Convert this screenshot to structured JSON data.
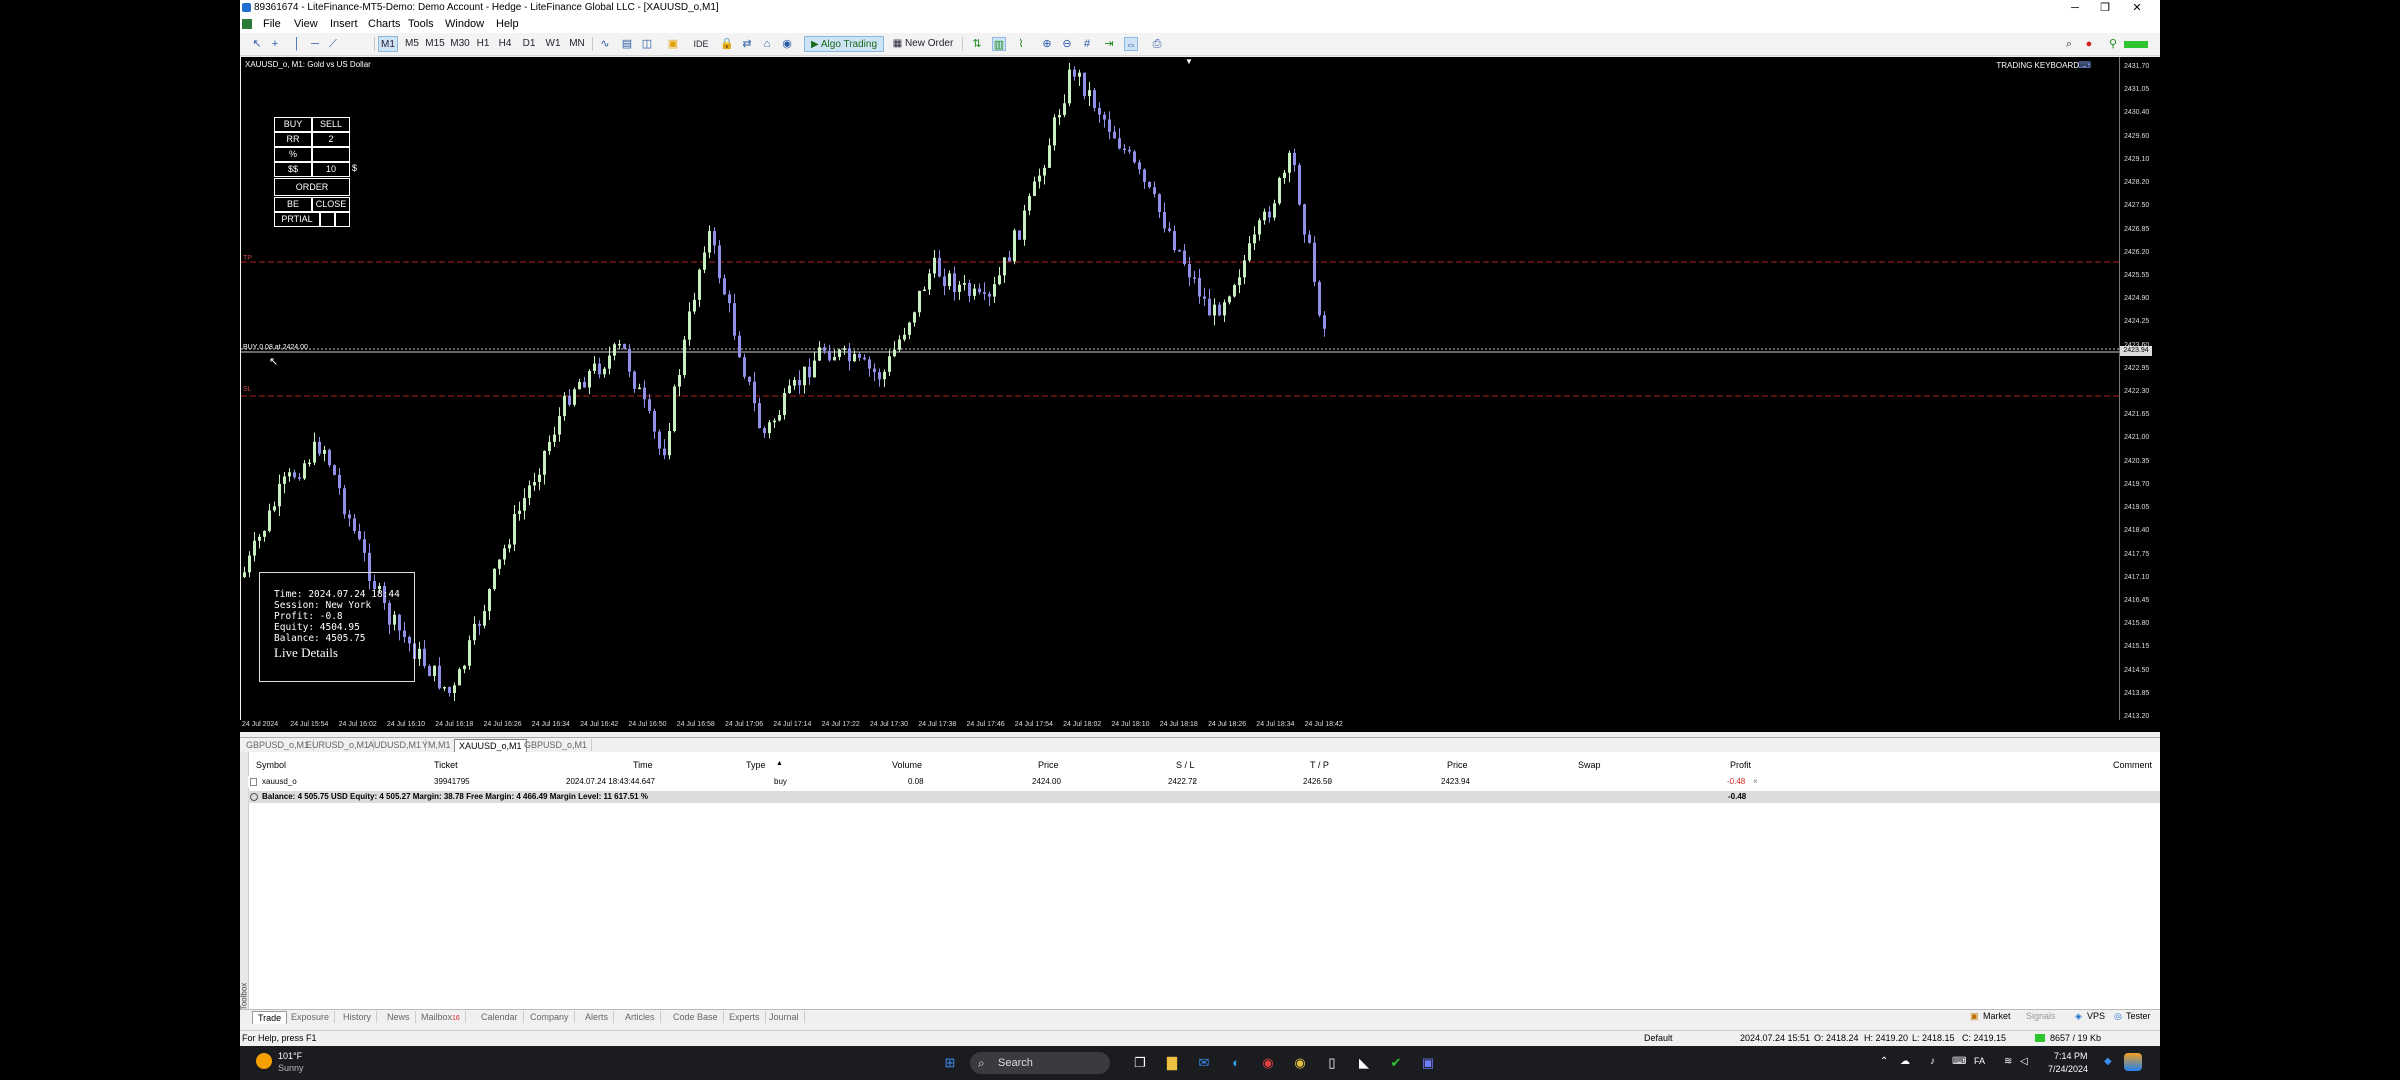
{
  "window": {
    "title": "89361674 - LiteFinance-MT5-Demo: Demo Account - Hedge - LiteFinance Global LLC - [XAUUSD_o,M1]",
    "minimize": "─",
    "maximize": "❐",
    "close": "✕"
  },
  "menu": [
    "File",
    "View",
    "Insert",
    "Charts",
    "Tools",
    "Window",
    "Help"
  ],
  "toolbar": {
    "timeframes": [
      "M1",
      "M5",
      "M15",
      "M30",
      "H1",
      "H4",
      "D1",
      "W1",
      "MN"
    ],
    "active_timeframe": "M1",
    "ide_label": "IDE",
    "algo_trading": "Algo Trading",
    "new_order": "New Order"
  },
  "chart": {
    "title": "XAUUSD_o, M1: Gold vs US Dollar",
    "trading_keyboard": "TRADING KEYBOARD",
    "tp_tag": "TP",
    "sl_tag": "SL",
    "position_label": "BUY 0.08 at 2424.00",
    "current_price": "2423.94",
    "price_ticks": [
      "2431.70",
      "2431.05",
      "2430.40",
      "2429.60",
      "2429.10",
      "2428.20",
      "2427.50",
      "2426.85",
      "2426.20",
      "2425.55",
      "2424.90",
      "2424.25",
      "2423.60",
      "2422.95",
      "2422.30",
      "2421.65",
      "2421.00",
      "2420.35",
      "2419.70",
      "2419.05",
      "2418.40",
      "2417.75",
      "2417.10",
      "2416.45",
      "2415.80",
      "2415.15",
      "2414.50",
      "2413.85",
      "2413.20"
    ],
    "time_ticks": [
      "24 Jul 2024",
      "24 Jul 15:54",
      "24 Jul 16:02",
      "24 Jul 16:10",
      "24 Jul 16:18",
      "24 Jul 16:26",
      "24 Jul 16:34",
      "24 Jul 16:42",
      "24 Jul 16:50",
      "24 Jul 16:58",
      "24 Jul 17:06",
      "24 Jul 17:14",
      "24 Jul 17:22",
      "24 Jul 17:30",
      "24 Jul 17:38",
      "24 Jul 17:46",
      "24 Jul 17:54",
      "24 Jul 18:02",
      "24 Jul 18:10",
      "24 Jul 18:18",
      "24 Jul 18:26",
      "24 Jul 18:34",
      "24 Jul 18:42"
    ]
  },
  "trade_panel": {
    "buy": "BUY",
    "sell": "SELL",
    "rr_label": "RR",
    "rr_value": "2",
    "pct_label": "%",
    "pct_value": "",
    "dollar_label": "$$",
    "dollar_value": "10",
    "dollar_suffix": "$",
    "order": "ORDER",
    "be": "BE",
    "close": "CLOSE",
    "partial": "PRTIAL"
  },
  "info_box": {
    "time": "Time: 2024.07.24 18:44",
    "session": "Session: New York",
    "profit": "Profit: -0.8",
    "equity": "Equity: 4504.95",
    "balance": "Balance: 4505.75",
    "live_details": "Live Details"
  },
  "chart_tabs": [
    "GBPUSD_o,M1",
    "EURUSD_o,M1",
    "AUDUSD,M1",
    "YM,M1",
    "XAUUSD_o,M1",
    "GBPUSD_o,M1"
  ],
  "chart_tabs_active": "XAUUSD_o,M1",
  "trade_table": {
    "headers": {
      "symbol": "Symbol",
      "ticket": "Ticket",
      "time": "Time",
      "type": "Type",
      "volume": "Volume",
      "price": "Price",
      "sl": "S / L",
      "tp": "T / P",
      "price2": "Price",
      "swap": "Swap",
      "profit": "Profit",
      "comment": "Comment"
    },
    "row": {
      "symbol": "xauusd_o",
      "ticket": "39941795",
      "time": "2024.07.24 18:43:44.647",
      "type": "buy",
      "volume": "0.08",
      "price": "2424.00",
      "sl": "2422.72",
      "tp": "2426.50",
      "price2": "2423.94",
      "profit": "-0.48"
    },
    "balance_line": "Balance: 4 505.75 USD  Equity: 4 505.27  Margin: 38.78  Free Margin: 4 466.49  Margin Level: 11 617.51 %",
    "balance_profit": "-0.48"
  },
  "bottom_tabs": [
    "Trade",
    "Exposure",
    "History",
    "News",
    "Mailbox",
    "Calendar",
    "Company",
    "Alerts",
    "Articles",
    "Code Base",
    "Experts",
    "Journal"
  ],
  "bottom_tabs_active": "Trade",
  "mailbox_badge": "16",
  "toolbox_label": "Toolbox",
  "right_links": {
    "market": "Market",
    "signals": "Signals",
    "vps": "VPS",
    "tester": "Tester"
  },
  "status": {
    "help": "For Help, press F1",
    "profile": "Default",
    "datetime": "2024.07.24 15:51",
    "open": "O: 2418.24",
    "high": "H: 2419.20",
    "low": "L: 2418.15",
    "close": "C: 2419.15",
    "traffic": "8657 / 19 Kb"
  },
  "taskbar": {
    "temp": "101°F",
    "weather": "Sunny",
    "search": "Search",
    "time": "7:14 PM",
    "date": "7/24/2024",
    "lang": "FA"
  },
  "colors": {
    "bull": "#c8f0c0",
    "bear": "#9090e8",
    "level": "#b02020",
    "accent": "#1f6fd0"
  }
}
